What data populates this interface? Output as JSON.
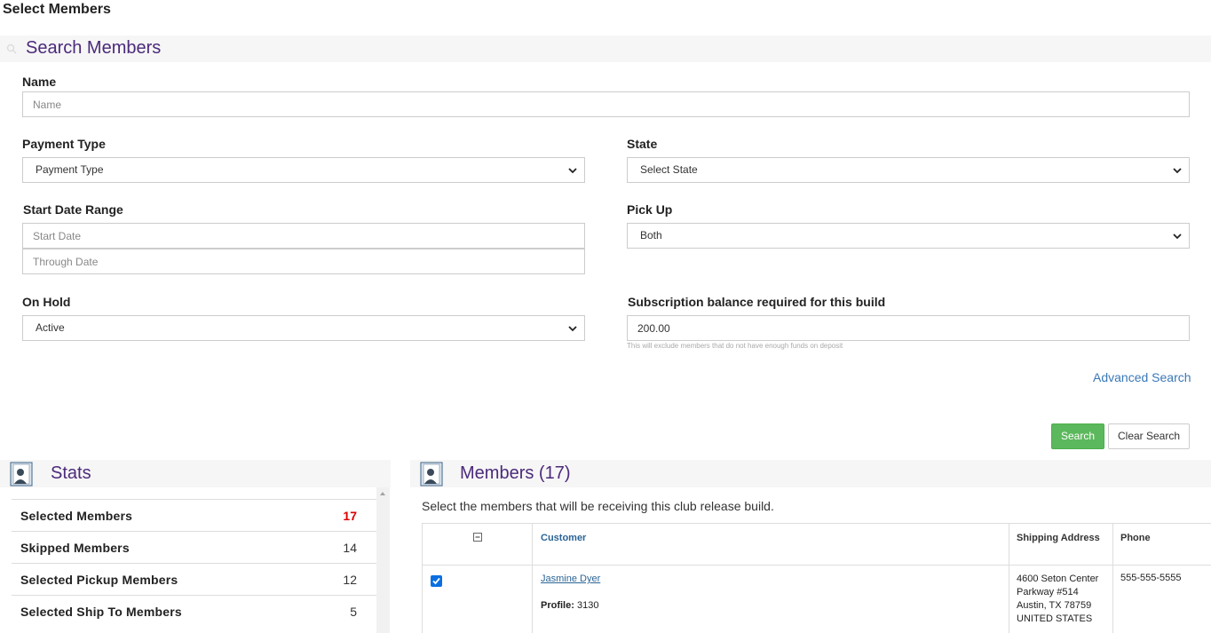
{
  "page": {
    "title": "Select Members"
  },
  "search": {
    "header": "Search Members",
    "name": {
      "label": "Name",
      "placeholder": "Name"
    },
    "payment_type": {
      "label": "Payment Type",
      "selected": "Payment Type"
    },
    "state": {
      "label": "State",
      "selected": "Select State"
    },
    "start_date_range": {
      "label": "Start Date Range",
      "start_placeholder": "Start Date",
      "through_placeholder": "Through Date"
    },
    "pick_up": {
      "label": "Pick Up",
      "selected": "Both"
    },
    "on_hold": {
      "label": "On Hold",
      "selected": "Active"
    },
    "subscription_balance": {
      "label": "Subscription balance required for this build",
      "value": "200.00",
      "hint": "This will exclude members that do not have enough funds on deposit"
    },
    "advanced_search_label": "Advanced Search",
    "search_button": "Search",
    "clear_button": "Clear Search"
  },
  "stats": {
    "title": "Stats",
    "rows": [
      {
        "label": "Selected Members",
        "value": "17"
      },
      {
        "label": "Skipped Members",
        "value": "14"
      },
      {
        "label": "Selected Pickup Members",
        "value": "12"
      },
      {
        "label": "Selected Ship To Members",
        "value": "5"
      }
    ]
  },
  "members": {
    "title": "Members (17)",
    "description": "Select the members that will be receiving this club release build.",
    "columns": {
      "customer": "Customer",
      "shipping_address": "Shipping Address",
      "phone": "Phone"
    },
    "rows": [
      {
        "name": "Jasmine Dyer",
        "profile_label": "Profile:",
        "profile_id": "3130",
        "address_lines": [
          "4600 Seton Center",
          "Parkway #514",
          "Austin, TX 78759",
          "UNITED STATES"
        ],
        "phone": "555-555-5555",
        "checked": true
      }
    ]
  },
  "colors": {
    "accent_purple": "#4b2a7a",
    "link_blue": "#2a6496",
    "success_green": "#5cb85c",
    "highlight_red": "#dd0000"
  },
  "icons": [
    "search-icon",
    "chevron-down-icon",
    "member-card-icon",
    "collapse-icon",
    "checkbox-checked-icon",
    "scroll-up-icon"
  ]
}
